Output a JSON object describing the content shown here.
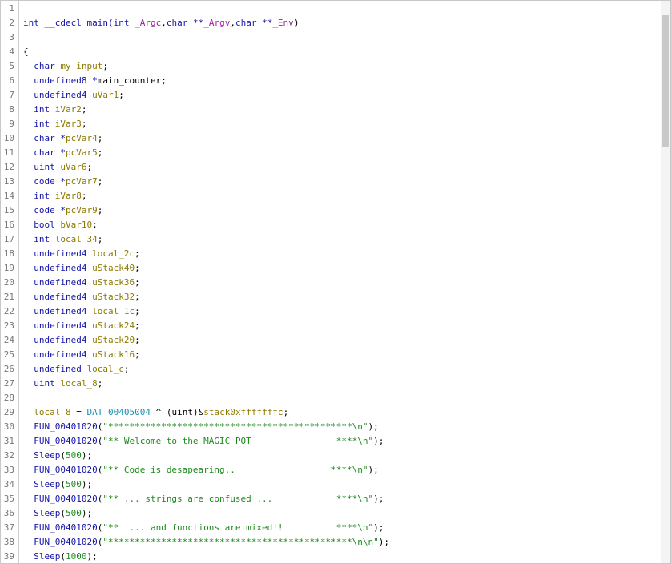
{
  "code_lines": [
    {
      "n": "1",
      "tokens": []
    },
    {
      "n": "2",
      "tokens": [
        {
          "t": "int __cdecl main(",
          "c": "kw"
        },
        {
          "t": "int ",
          "c": "type"
        },
        {
          "t": "_Argc",
          "c": "param"
        },
        {
          "t": ",",
          "c": "punct"
        },
        {
          "t": "char **",
          "c": "type"
        },
        {
          "t": "_Argv",
          "c": "param"
        },
        {
          "t": ",",
          "c": "punct"
        },
        {
          "t": "char **",
          "c": "type"
        },
        {
          "t": "_Env",
          "c": "param"
        },
        {
          "t": ")",
          "c": "punct"
        }
      ]
    },
    {
      "n": "3",
      "tokens": []
    },
    {
      "n": "4",
      "tokens": [
        {
          "t": "{",
          "c": "punct"
        }
      ]
    },
    {
      "n": "5",
      "tokens": [
        {
          "t": "  char ",
          "c": "type"
        },
        {
          "t": "my_input",
          "c": "var"
        },
        {
          "t": ";",
          "c": "punct"
        }
      ]
    },
    {
      "n": "6",
      "tokens": [
        {
          "t": "  undefined8 *",
          "c": "type"
        },
        {
          "t": "main_counter",
          "c": "default"
        },
        {
          "t": ";",
          "c": "punct"
        }
      ]
    },
    {
      "n": "7",
      "tokens": [
        {
          "t": "  undefined4 ",
          "c": "type"
        },
        {
          "t": "uVar1",
          "c": "var"
        },
        {
          "t": ";",
          "c": "punct"
        }
      ]
    },
    {
      "n": "8",
      "tokens": [
        {
          "t": "  int ",
          "c": "type"
        },
        {
          "t": "iVar2",
          "c": "var"
        },
        {
          "t": ";",
          "c": "punct"
        }
      ]
    },
    {
      "n": "9",
      "tokens": [
        {
          "t": "  int ",
          "c": "type"
        },
        {
          "t": "iVar3",
          "c": "var"
        },
        {
          "t": ";",
          "c": "punct"
        }
      ]
    },
    {
      "n": "10",
      "tokens": [
        {
          "t": "  char *",
          "c": "type"
        },
        {
          "t": "pcVar4",
          "c": "var"
        },
        {
          "t": ";",
          "c": "punct"
        }
      ]
    },
    {
      "n": "11",
      "tokens": [
        {
          "t": "  char *",
          "c": "type"
        },
        {
          "t": "pcVar5",
          "c": "var"
        },
        {
          "t": ";",
          "c": "punct"
        }
      ]
    },
    {
      "n": "12",
      "tokens": [
        {
          "t": "  uint ",
          "c": "type"
        },
        {
          "t": "uVar6",
          "c": "var"
        },
        {
          "t": ";",
          "c": "punct"
        }
      ]
    },
    {
      "n": "13",
      "tokens": [
        {
          "t": "  code *",
          "c": "type"
        },
        {
          "t": "pcVar7",
          "c": "var"
        },
        {
          "t": ";",
          "c": "punct"
        }
      ]
    },
    {
      "n": "14",
      "tokens": [
        {
          "t": "  int ",
          "c": "type"
        },
        {
          "t": "iVar8",
          "c": "var"
        },
        {
          "t": ";",
          "c": "punct"
        }
      ]
    },
    {
      "n": "15",
      "tokens": [
        {
          "t": "  code *",
          "c": "type"
        },
        {
          "t": "pcVar9",
          "c": "var"
        },
        {
          "t": ";",
          "c": "punct"
        }
      ]
    },
    {
      "n": "16",
      "tokens": [
        {
          "t": "  bool ",
          "c": "type"
        },
        {
          "t": "bVar10",
          "c": "var"
        },
        {
          "t": ";",
          "c": "punct"
        }
      ]
    },
    {
      "n": "17",
      "tokens": [
        {
          "t": "  int ",
          "c": "type"
        },
        {
          "t": "local_34",
          "c": "var"
        },
        {
          "t": ";",
          "c": "punct"
        }
      ]
    },
    {
      "n": "18",
      "tokens": [
        {
          "t": "  undefined4 ",
          "c": "type"
        },
        {
          "t": "local_2c",
          "c": "var"
        },
        {
          "t": ";",
          "c": "punct"
        }
      ]
    },
    {
      "n": "19",
      "tokens": [
        {
          "t": "  undefined4 ",
          "c": "type"
        },
        {
          "t": "uStack40",
          "c": "var"
        },
        {
          "t": ";",
          "c": "punct"
        }
      ]
    },
    {
      "n": "20",
      "tokens": [
        {
          "t": "  undefined4 ",
          "c": "type"
        },
        {
          "t": "uStack36",
          "c": "var"
        },
        {
          "t": ";",
          "c": "punct"
        }
      ]
    },
    {
      "n": "21",
      "tokens": [
        {
          "t": "  undefined4 ",
          "c": "type"
        },
        {
          "t": "uStack32",
          "c": "var"
        },
        {
          "t": ";",
          "c": "punct"
        }
      ]
    },
    {
      "n": "22",
      "tokens": [
        {
          "t": "  undefined4 ",
          "c": "type"
        },
        {
          "t": "local_1c",
          "c": "var"
        },
        {
          "t": ";",
          "c": "punct"
        }
      ]
    },
    {
      "n": "23",
      "tokens": [
        {
          "t": "  undefined4 ",
          "c": "type"
        },
        {
          "t": "uStack24",
          "c": "var"
        },
        {
          "t": ";",
          "c": "punct"
        }
      ]
    },
    {
      "n": "24",
      "tokens": [
        {
          "t": "  undefined4 ",
          "c": "type"
        },
        {
          "t": "uStack20",
          "c": "var"
        },
        {
          "t": ";",
          "c": "punct"
        }
      ]
    },
    {
      "n": "25",
      "tokens": [
        {
          "t": "  undefined4 ",
          "c": "type"
        },
        {
          "t": "uStack16",
          "c": "var"
        },
        {
          "t": ";",
          "c": "punct"
        }
      ]
    },
    {
      "n": "26",
      "tokens": [
        {
          "t": "  undefined ",
          "c": "type"
        },
        {
          "t": "local_c",
          "c": "var"
        },
        {
          "t": ";",
          "c": "punct"
        }
      ]
    },
    {
      "n": "27",
      "tokens": [
        {
          "t": "  uint ",
          "c": "type"
        },
        {
          "t": "local_8",
          "c": "var"
        },
        {
          "t": ";",
          "c": "punct"
        }
      ]
    },
    {
      "n": "28",
      "tokens": []
    },
    {
      "n": "29",
      "tokens": [
        {
          "t": "  local_8",
          "c": "var"
        },
        {
          "t": " = ",
          "c": "punct"
        },
        {
          "t": "DAT_00405004",
          "c": "data"
        },
        {
          "t": " ^ ",
          "c": "punct"
        },
        {
          "t": "(uint)",
          "c": "punct"
        },
        {
          "t": "&",
          "c": "punct"
        },
        {
          "t": "stack0xfffffffc",
          "c": "var"
        },
        {
          "t": ";",
          "c": "punct"
        }
      ]
    },
    {
      "n": "30",
      "tokens": [
        {
          "t": "  FUN_00401020",
          "c": "fn"
        },
        {
          "t": "(",
          "c": "punct"
        },
        {
          "t": "\"**********************************************\\n\"",
          "c": "str"
        },
        {
          "t": ");",
          "c": "punct"
        }
      ]
    },
    {
      "n": "31",
      "tokens": [
        {
          "t": "  FUN_00401020",
          "c": "fn"
        },
        {
          "t": "(",
          "c": "punct"
        },
        {
          "t": "\"** Welcome to the MAGIC POT                ****\\n\"",
          "c": "str"
        },
        {
          "t": ");",
          "c": "punct"
        }
      ]
    },
    {
      "n": "32",
      "tokens": [
        {
          "t": "  Sleep",
          "c": "fn"
        },
        {
          "t": "(",
          "c": "punct"
        },
        {
          "t": "500",
          "c": "num"
        },
        {
          "t": ");",
          "c": "punct"
        }
      ]
    },
    {
      "n": "33",
      "tokens": [
        {
          "t": "  FUN_00401020",
          "c": "fn"
        },
        {
          "t": "(",
          "c": "punct"
        },
        {
          "t": "\"** Code is desapearing..                  ****\\n\"",
          "c": "str"
        },
        {
          "t": ");",
          "c": "punct"
        }
      ]
    },
    {
      "n": "34",
      "tokens": [
        {
          "t": "  Sleep",
          "c": "fn"
        },
        {
          "t": "(",
          "c": "punct"
        },
        {
          "t": "500",
          "c": "num"
        },
        {
          "t": ");",
          "c": "punct"
        }
      ]
    },
    {
      "n": "35",
      "tokens": [
        {
          "t": "  FUN_00401020",
          "c": "fn"
        },
        {
          "t": "(",
          "c": "punct"
        },
        {
          "t": "\"** ... strings are confused ...            ****\\n\"",
          "c": "str"
        },
        {
          "t": ");",
          "c": "punct"
        }
      ]
    },
    {
      "n": "36",
      "tokens": [
        {
          "t": "  Sleep",
          "c": "fn"
        },
        {
          "t": "(",
          "c": "punct"
        },
        {
          "t": "500",
          "c": "num"
        },
        {
          "t": ");",
          "c": "punct"
        }
      ]
    },
    {
      "n": "37",
      "tokens": [
        {
          "t": "  FUN_00401020",
          "c": "fn"
        },
        {
          "t": "(",
          "c": "punct"
        },
        {
          "t": "\"**  ... and functions are mixed!!          ****\\n\"",
          "c": "str"
        },
        {
          "t": ");",
          "c": "punct"
        }
      ]
    },
    {
      "n": "38",
      "tokens": [
        {
          "t": "  FUN_00401020",
          "c": "fn"
        },
        {
          "t": "(",
          "c": "punct"
        },
        {
          "t": "\"**********************************************\\n\\n\"",
          "c": "str"
        },
        {
          "t": ");",
          "c": "punct"
        }
      ]
    },
    {
      "n": "39",
      "tokens": [
        {
          "t": "  Sleep",
          "c": "fn"
        },
        {
          "t": "(",
          "c": "punct"
        },
        {
          "t": "1000",
          "c": "num"
        },
        {
          "t": ");",
          "c": "punct"
        }
      ]
    }
  ]
}
